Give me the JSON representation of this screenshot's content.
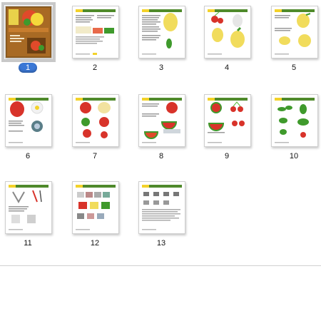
{
  "window": {
    "title": ""
  },
  "thumbnails": [
    {
      "label": "1",
      "selected": true
    },
    {
      "label": "2",
      "selected": false
    },
    {
      "label": "3",
      "selected": false
    },
    {
      "label": "4",
      "selected": false
    },
    {
      "label": "5",
      "selected": false
    },
    {
      "label": "6",
      "selected": false
    },
    {
      "label": "7",
      "selected": false
    },
    {
      "label": "8",
      "selected": false
    },
    {
      "label": "9",
      "selected": false
    },
    {
      "label": "10",
      "selected": false
    },
    {
      "label": "11",
      "selected": false
    },
    {
      "label": "12",
      "selected": false
    },
    {
      "label": "13",
      "selected": false
    }
  ],
  "colors": {
    "selection_badge": "#3b78d6",
    "header_green": "#4f8a2b",
    "header_yellow": "#f3d22a",
    "cover_brown": "#8b5a1e"
  }
}
